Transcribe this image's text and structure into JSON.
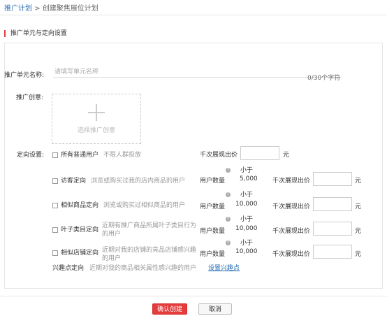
{
  "breadcrumb": {
    "root": "推广计划",
    "separator": ">",
    "current": "创建聚焦展位计划"
  },
  "section_title": "推广单元与定向设置",
  "unit_name": {
    "label": "推广单元名称:",
    "placeholder": "请填写单元名称",
    "counter": "0/30个字符"
  },
  "creative": {
    "label": "推广创意:",
    "add_label": "选择推广创意"
  },
  "targeting": {
    "label": "定向设置:",
    "all_users": {
      "name": "所有普通用户",
      "desc": "不限人群投放",
      "price_label": "千次展现出价",
      "unit": "元"
    },
    "rows": [
      {
        "name": "访客定向",
        "desc": "浏览或购买过我的店内商品的用户",
        "count_label": "用户数量",
        "less_than": "小于",
        "count": "5,000",
        "price_label": "千次展现出价",
        "unit": "元"
      },
      {
        "name": "相似商品定向",
        "desc": "浏览或购买过相似商品的用户",
        "count_label": "用户数量",
        "less_than": "小于",
        "count": "10,000",
        "price_label": "千次展现出价",
        "unit": "元"
      },
      {
        "name": "叶子类目定向",
        "desc": "近期有推广商品所属叶子类目行为的用户",
        "count_label": "用户数量",
        "less_than": "小于",
        "count": "10,000",
        "price_label": "千次展现出价",
        "unit": "元"
      },
      {
        "name": "相似店铺定向",
        "desc": "近期对我的店铺的竟品店铺感兴趣的用户",
        "count_label": "用户数量",
        "less_than": "小于",
        "count": "10,000",
        "price_label": "千次展现出价",
        "unit": "元"
      }
    ],
    "interest": {
      "name": "兴趣点定向",
      "desc": "近期对我的商品相关属性感兴趣的用户",
      "link": "设置兴趣点"
    }
  },
  "buttons": {
    "confirm": "确认创建",
    "cancel": "取消"
  },
  "colors": {
    "accent_red": "#e53b3b",
    "link_blue": "#2b6fb5"
  }
}
